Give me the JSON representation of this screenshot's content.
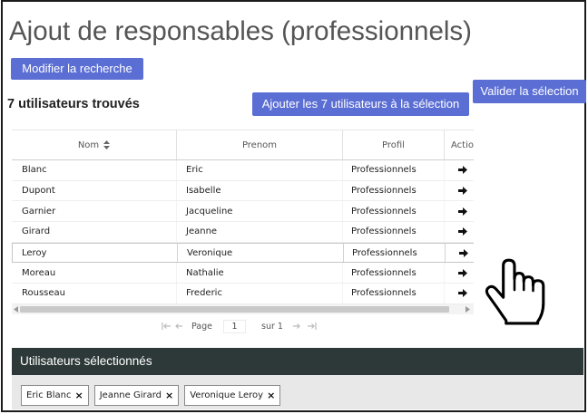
{
  "page": {
    "title": "Ajout de responsables (professionnels)"
  },
  "toolbar": {
    "modify_search_label": "Modifier la recherche",
    "add_all_label": "Ajouter les 7 utilisateurs à la sélection",
    "validate_label": "Valider la sélection"
  },
  "results": {
    "count_text": "7 utilisateurs trouvés"
  },
  "table": {
    "columns": [
      {
        "label": "Nom",
        "icon": "sort-icon"
      },
      {
        "label": "Prenom"
      },
      {
        "label": "Profil"
      },
      {
        "label": "Actio"
      }
    ],
    "rows": [
      {
        "nom": "Blanc",
        "prenom": "Eric",
        "profil": "Professionnels",
        "action_icon": "arrow-right-icon"
      },
      {
        "nom": "Dupont",
        "prenom": "Isabelle",
        "profil": "Professionnels",
        "action_icon": "arrow-right-icon"
      },
      {
        "nom": "Garnier",
        "prenom": "Jacqueline",
        "profil": "Professionnels",
        "action_icon": "arrow-right-icon"
      },
      {
        "nom": "Girard",
        "prenom": "Jeanne",
        "profil": "Professionnels",
        "action_icon": "arrow-right-icon"
      },
      {
        "nom": "Leroy",
        "prenom": "Veronique",
        "profil": "Professionnels",
        "action_icon": "arrow-right-icon",
        "hovered": true
      },
      {
        "nom": "Moreau",
        "prenom": "Nathalie",
        "profil": "Professionnels",
        "action_icon": "arrow-right-icon"
      },
      {
        "nom": "Rousseau",
        "prenom": "Frederic",
        "profil": "Professionnels",
        "action_icon": "arrow-right-icon"
      }
    ],
    "scrollbar": {
      "left_icon": "scroll-left-icon",
      "right_icon": "scroll-right-icon"
    }
  },
  "pager": {
    "first_icon": "first-page-icon",
    "prev_icon": "prev-page-icon",
    "page_label": "Page",
    "page_value": "1",
    "total_text": "sur 1",
    "next_icon": "next-page-icon",
    "last_icon": "last-page-icon"
  },
  "cursor": {
    "icon": "hand-pointer-icon"
  },
  "selection": {
    "title": "Utilisateurs sélectionnés",
    "remove_symbol": "×",
    "tags": [
      {
        "label": "Eric Blanc"
      },
      {
        "label": "Jeanne Girard"
      },
      {
        "label": "Veronique Leroy"
      }
    ]
  },
  "colors": {
    "button_bg": "#5b6ed4",
    "button_text": "#ffffff",
    "title_text": "#555555",
    "selection_bar_bg": "#2d3938",
    "selection_area_bg": "#e8e8e8"
  }
}
